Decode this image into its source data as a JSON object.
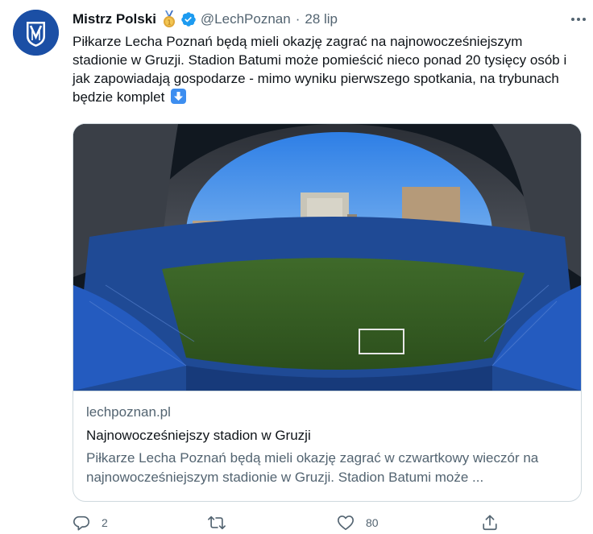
{
  "tweet": {
    "display_name": "Mistrz Polski",
    "handle": "@LechPoznan",
    "separator": "·",
    "date": "28 lip",
    "text": "Piłkarze Lecha Poznań będą mieli okazję zagrać na najnowocześniejszym stadionie w Gruzji. Stadion Batumi może pomieścić nieco ponad 20 tysięcy osób i jak zapowiadają gospodarze - mimo wyniku pierwszego spotkania, na trybunach będzie komplet",
    "emoji": "down-arrow-emoji"
  },
  "card": {
    "image": "stadium-photo",
    "domain": "lechpoznan.pl",
    "title": "Najnowocześniejszy stadion w Gruzji",
    "description": "Piłkarze Lecha Poznań będą mieli okazję zagrać w czwartkowy wieczór na najnowocześniejszym stadionie w Gruzji. Stadion Batumi może ..."
  },
  "actions": {
    "reply_count": "2",
    "retweet_count": "",
    "like_count": "80"
  },
  "icons": {
    "avatar": "lech-poznan-crest",
    "badge": "gold-medal-icon",
    "verified": "verified-badge-icon",
    "more": "more-icon",
    "reply": "reply-icon",
    "retweet": "retweet-icon",
    "like": "heart-icon",
    "share": "share-icon"
  },
  "colors": {
    "verified": "#1d9bf0",
    "text_secondary": "#536471",
    "text_primary": "#0f1419",
    "border": "#cfd9de",
    "avatar_bg": "#1b4fa5"
  }
}
